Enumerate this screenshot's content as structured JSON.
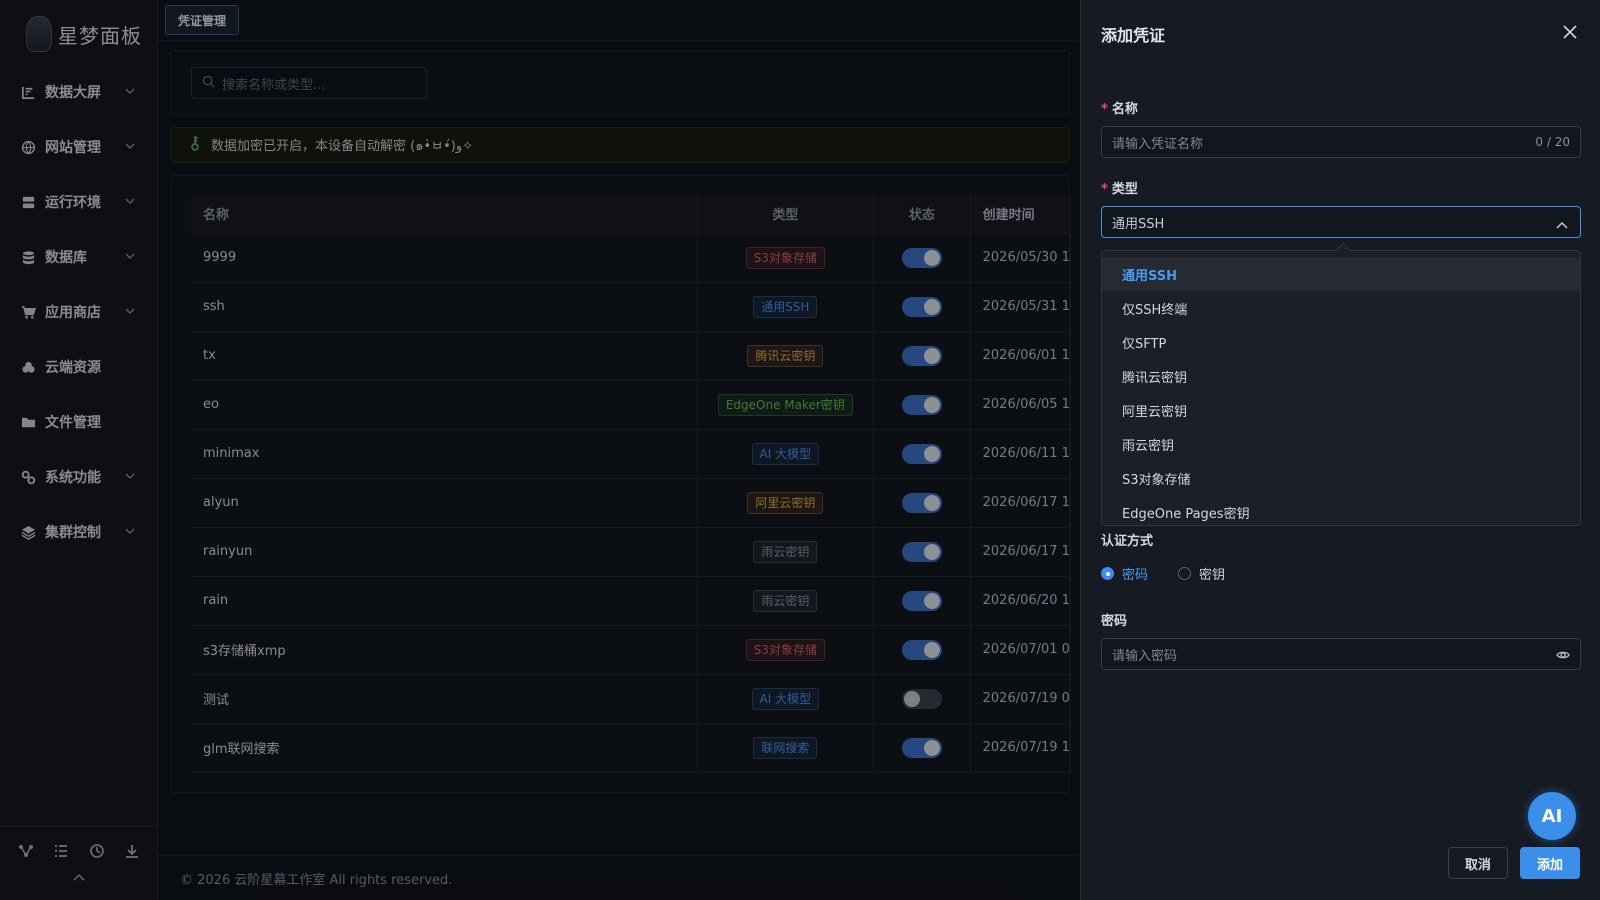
{
  "brand": {
    "logo_text": "星梦面板"
  },
  "sidebar": {
    "items": [
      {
        "label": "数据大屏",
        "icon": "chart-icon",
        "chevron": true
      },
      {
        "label": "网站管理",
        "icon": "globe-icon",
        "chevron": true
      },
      {
        "label": "运行环境",
        "icon": "server-icon",
        "chevron": true
      },
      {
        "label": "数据库",
        "icon": "database-icon",
        "chevron": true
      },
      {
        "label": "应用商店",
        "icon": "cart-icon",
        "chevron": true
      },
      {
        "label": "云端资源",
        "icon": "cloud-icon",
        "chevron": false
      },
      {
        "label": "文件管理",
        "icon": "folder-icon",
        "chevron": false
      },
      {
        "label": "系统功能",
        "icon": "gears-icon",
        "chevron": true
      },
      {
        "label": "集群控制",
        "icon": "layers-icon",
        "chevron": true
      }
    ]
  },
  "header": {
    "tab_label": "凭证管理"
  },
  "search": {
    "placeholder": "搜索名称或类型..."
  },
  "notice": {
    "text": "数据加密已开启，本设备自动解密 (๑•̀ㅂ•́)و✧"
  },
  "table": {
    "headers": [
      "名称",
      "类型",
      "状态",
      "创建时间"
    ],
    "rows": [
      {
        "name": "9999",
        "type": "S3对象存储",
        "tag_color": "#e05a5a",
        "enabled": true,
        "created": "2026/05/30 1"
      },
      {
        "name": "ssh",
        "type": "通用SSH",
        "tag_color": "#4a8fe6",
        "enabled": true,
        "created": "2026/05/31 1"
      },
      {
        "name": "tx",
        "type": "腾讯云密钥",
        "tag_color": "#e0a040",
        "enabled": true,
        "created": "2026/06/01 1"
      },
      {
        "name": "eo",
        "type": "EdgeOne Maker密钥",
        "tag_color": "#5bbd55",
        "enabled": true,
        "created": "2026/06/05 1"
      },
      {
        "name": "minimax",
        "type": "AI 大模型",
        "tag_color": "#4a8fe6",
        "enabled": true,
        "created": "2026/06/11 1"
      },
      {
        "name": "alyun",
        "type": "阿里云密钥",
        "tag_color": "#e0a040",
        "enabled": true,
        "created": "2026/06/17 1"
      },
      {
        "name": "rainyun",
        "type": "雨云密钥",
        "tag_color": "#8a909c",
        "enabled": true,
        "created": "2026/06/17 1"
      },
      {
        "name": "rain",
        "type": "雨云密钥",
        "tag_color": "#8a909c",
        "enabled": true,
        "created": "2026/06/20 1"
      },
      {
        "name": "s3存储桶xmp",
        "type": "S3对象存储",
        "tag_color": "#e05a5a",
        "enabled": true,
        "created": "2026/07/01 0"
      },
      {
        "name": "测试",
        "type": "AI 大模型",
        "tag_color": "#4a8fe6",
        "enabled": false,
        "created": "2026/07/19 0"
      },
      {
        "name": "glm联网搜索",
        "type": "联网搜索",
        "tag_color": "#4a8fe6",
        "enabled": true,
        "created": "2026/07/19 1"
      }
    ]
  },
  "footer": {
    "copyright": "© 2026 云阶星幕工作室 All rights reserved."
  },
  "drawer": {
    "title": "添加凭证",
    "name_label": "名称",
    "name_placeholder": "请输入凭证名称",
    "name_count": "0 / 20",
    "type_label": "类型",
    "type_value": "通用SSH",
    "type_options": [
      "通用SSH",
      "仅SSH终端",
      "仅SFTP",
      "腾讯云密钥",
      "阿里云密钥",
      "雨云密钥",
      "S3对象存储",
      "EdgeOne Pages密钥"
    ],
    "auth_label": "认证方式",
    "auth_options": [
      {
        "label": "密码",
        "checked": true
      },
      {
        "label": "密钥",
        "checked": false
      }
    ],
    "password_label": "密码",
    "password_placeholder": "请输入密码",
    "cancel_label": "取消",
    "submit_label": "添加",
    "ai_label": "AI"
  },
  "colors": {
    "accent": "#3b8fea",
    "required": "#e45656"
  }
}
